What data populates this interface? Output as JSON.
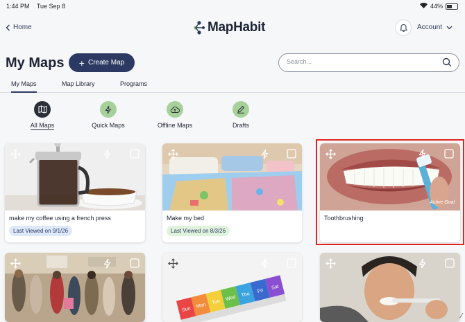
{
  "status": {
    "time": "1:44 PM",
    "date": "Tue Sep 8",
    "battery": "44%"
  },
  "nav": {
    "home_label": "Home",
    "logo_text": "MapHabit",
    "account_label": "Account"
  },
  "header": {
    "title": "My Maps",
    "create_label": "Create Map",
    "search_placeholder": "Search..."
  },
  "tabs": [
    {
      "label": "My Maps",
      "active": true
    },
    {
      "label": "Map Library"
    },
    {
      "label": "Programs"
    }
  ],
  "filters": [
    {
      "label": "All Maps",
      "icon": "map-icon",
      "active": true
    },
    {
      "label": "Quick Maps",
      "icon": "lightning-icon"
    },
    {
      "label": "Offline Maps",
      "icon": "cloud-upload-icon"
    },
    {
      "label": "Drafts",
      "icon": "pencil-icon"
    }
  ],
  "maps": [
    {
      "title": "make my coffee using a french press",
      "last_viewed": "Last Viewed on 9/1/26",
      "image": "french-press"
    },
    {
      "title": "Make my bed",
      "last_viewed": "Last Viewed on 8/3/26",
      "image": "bed"
    },
    {
      "title": "Toothbrushing",
      "last_viewed": "",
      "image": "toothbrush",
      "overlay_text": "Active Goal",
      "selected": true
    },
    {
      "title": "",
      "image": "crowd"
    },
    {
      "title": "",
      "image": "pill-organizer",
      "days": [
        "Sun",
        "Mon",
        "Tue",
        "Wed",
        "Thu",
        "Fri",
        "Sat"
      ]
    },
    {
      "title": "",
      "image": "person-brushing"
    }
  ],
  "colors": {
    "primary": "#2c3a63",
    "accent_green": "#a7d19a",
    "selected_border": "#e0261f",
    "badge_blue": "#dde9f9",
    "badge_green": "#dff2dc"
  }
}
